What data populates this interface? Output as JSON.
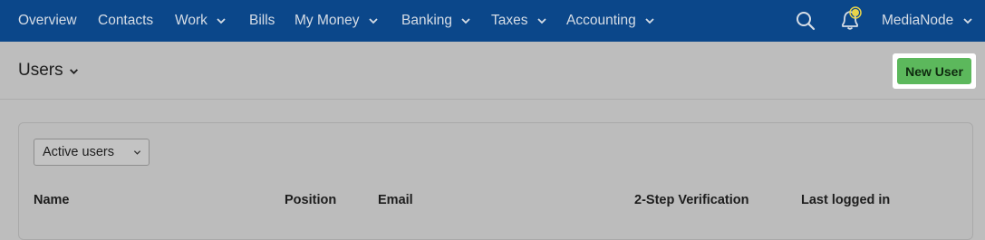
{
  "nav": {
    "items": [
      {
        "label": "Overview",
        "has_chevron": false
      },
      {
        "label": "Contacts",
        "has_chevron": false
      },
      {
        "label": "Work",
        "has_chevron": true
      },
      {
        "label": "Bills",
        "has_chevron": false
      },
      {
        "label": "My Money",
        "has_chevron": true
      },
      {
        "label": "Banking",
        "has_chevron": true
      },
      {
        "label": "Taxes",
        "has_chevron": true
      },
      {
        "label": "Accounting",
        "has_chevron": true
      }
    ],
    "search_icon": "search-icon",
    "notification_icon": "bell-icon",
    "organization": "MediaNode"
  },
  "page": {
    "title": "Users",
    "new_user_label": "New User"
  },
  "filter": {
    "selected": "Active users"
  },
  "table": {
    "columns": [
      "Name",
      "Position",
      "Email",
      "2-Step Verification",
      "Last logged in"
    ]
  },
  "colors": {
    "nav_bg": "#0b478a",
    "accent_green": "#5cb85c",
    "badge_yellow": "#e8d44a"
  }
}
